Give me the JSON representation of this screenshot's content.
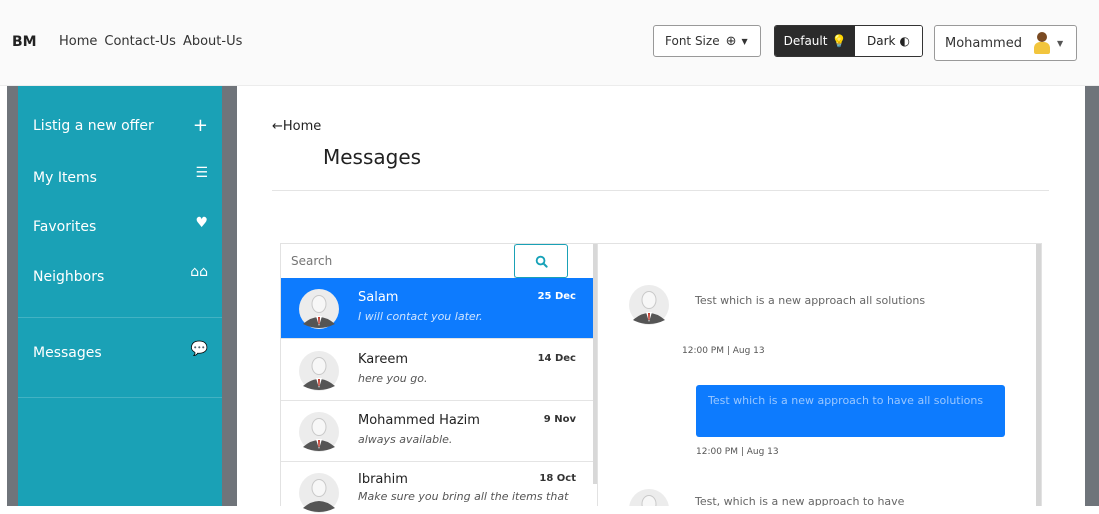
{
  "navbar": {
    "brand": "BM",
    "links": [
      "Home",
      "Contact-Us",
      "About-Us"
    ],
    "font_size_label": "Font Size",
    "theme_default": "Default",
    "theme_dark": "Dark",
    "user_name": "Mohammed"
  },
  "sidebar": {
    "items": [
      {
        "label": "Listig a new offer",
        "icon": "plus-icon"
      },
      {
        "label": "My Items",
        "icon": "list-icon"
      },
      {
        "label": "Favorites",
        "icon": "heart-icon"
      },
      {
        "label": "Neighbors",
        "icon": "houses-icon"
      },
      {
        "label": "Messages",
        "icon": "chat-bubbles-icon"
      }
    ]
  },
  "main": {
    "back_label": "Home",
    "title": "Messages",
    "search_placeholder": "Search"
  },
  "conversations": [
    {
      "name": "Salam",
      "date": "25 Dec",
      "preview": "I will contact you later.",
      "active": true
    },
    {
      "name": "Kareem",
      "date": "14 Dec",
      "preview": "here you go.",
      "active": false
    },
    {
      "name": "Mohammed Hazim",
      "date": "9 Nov",
      "preview": "always available.",
      "active": false
    },
    {
      "name": "Ibrahim",
      "date": "18 Oct",
      "preview": "Make sure you bring all the items that",
      "active": false
    }
  ],
  "chat": {
    "messages": [
      {
        "text": "Test which is a new approach all solutions",
        "time": "12:00 PM | Aug 13"
      },
      {
        "text": "Test which is a new approach to have all solutions",
        "time": "12:00 PM | Aug 13"
      },
      {
        "text": "Test, which is a new approach to have"
      }
    ]
  },
  "colors": {
    "sidebar": "#1aa1b6",
    "active_item": "#0d7bfe",
    "outgoing_bubble": "#0d7bfe"
  }
}
